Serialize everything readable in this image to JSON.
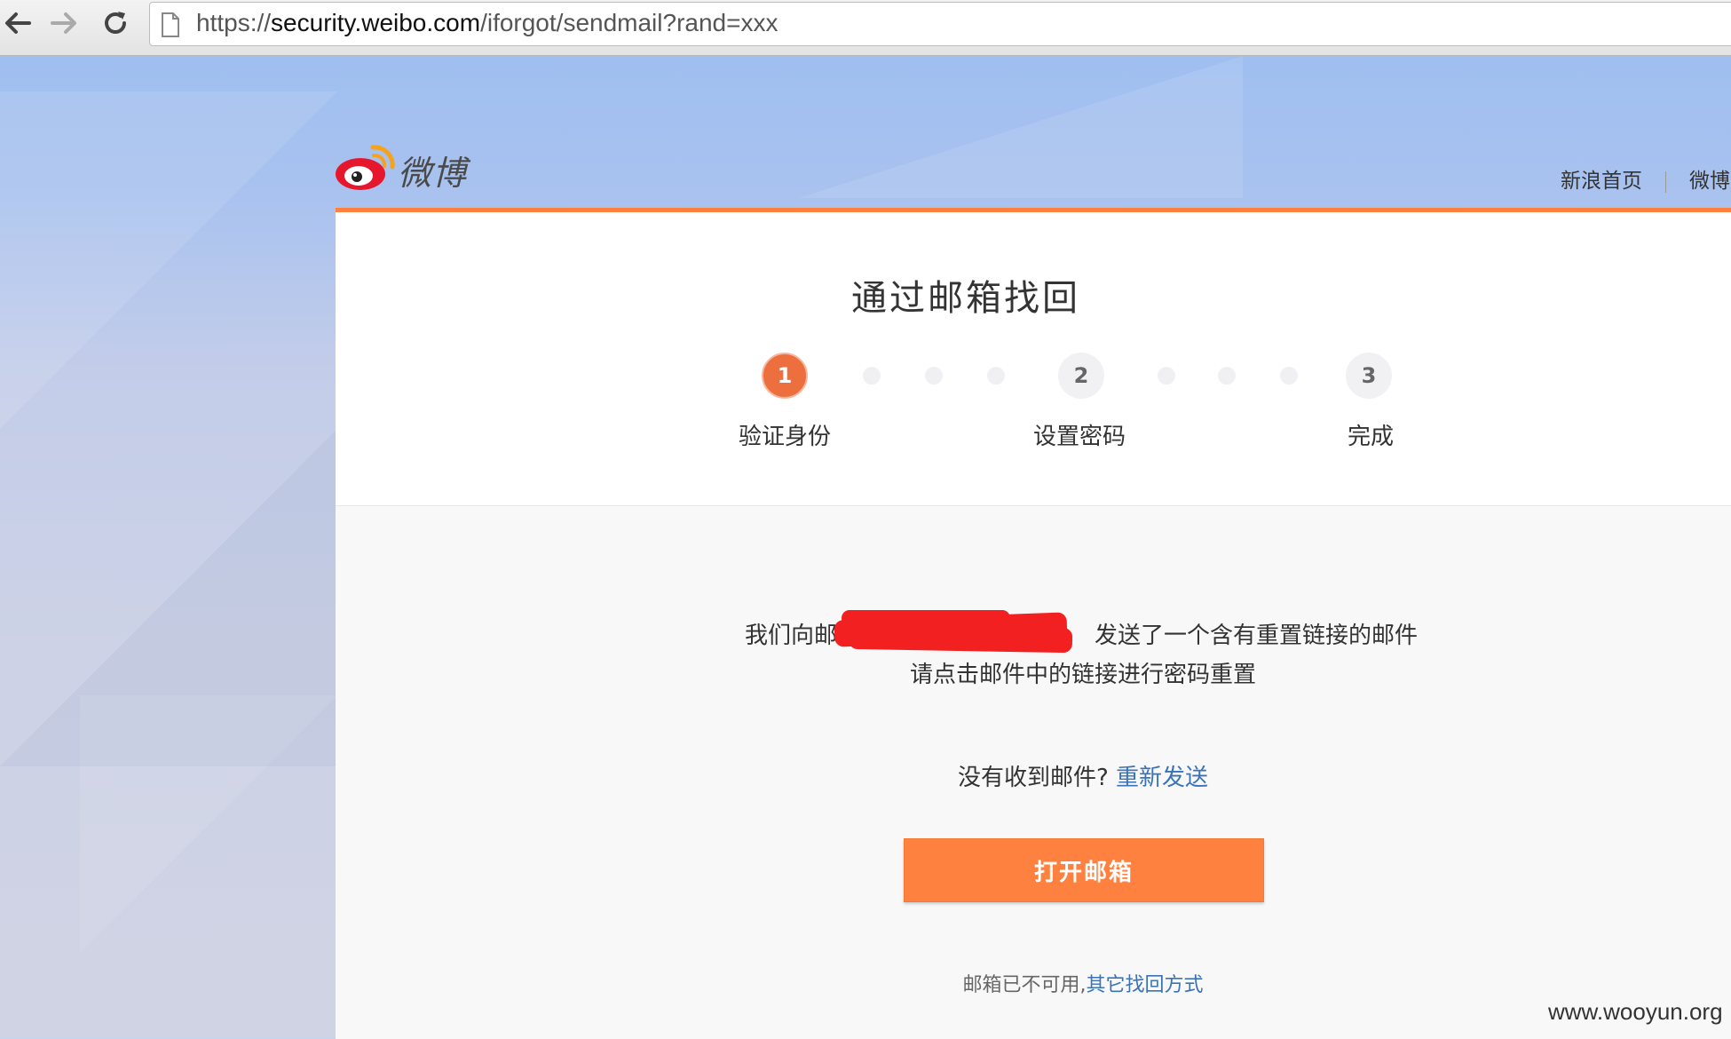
{
  "browser": {
    "url_scheme": "https://",
    "url_host": "security.weibo.com",
    "url_path": "/iforgot/sendmail?rand=xxx"
  },
  "header": {
    "logo_text": "微博",
    "links": [
      "新浪首页",
      "微博"
    ]
  },
  "card": {
    "title": "通过邮箱找回",
    "steps": [
      {
        "number": "1",
        "label": "验证身份",
        "status": "active"
      },
      {
        "number": "2",
        "label": "设置密码",
        "status": "pending"
      },
      {
        "number": "3",
        "label": "完成",
        "status": "pending"
      }
    ],
    "message_prefix": "我们向邮箱",
    "message_suffix": "发送了一个含有重置链接的邮件",
    "message_line2": "请点击邮件中的链接进行密码重置",
    "resend_question": "没有收到邮件?",
    "resend_link": "重新发送",
    "open_mailbox_button": "打开邮箱",
    "unavailable_text": "邮箱已不可用,",
    "other_method_link": "其它找回方式"
  },
  "colors": {
    "accent": "#ff8140",
    "active_step": "#ee6f3e",
    "link": "#3a73b8",
    "redaction": "#f22020"
  },
  "watermark": "www.wooyun.org"
}
